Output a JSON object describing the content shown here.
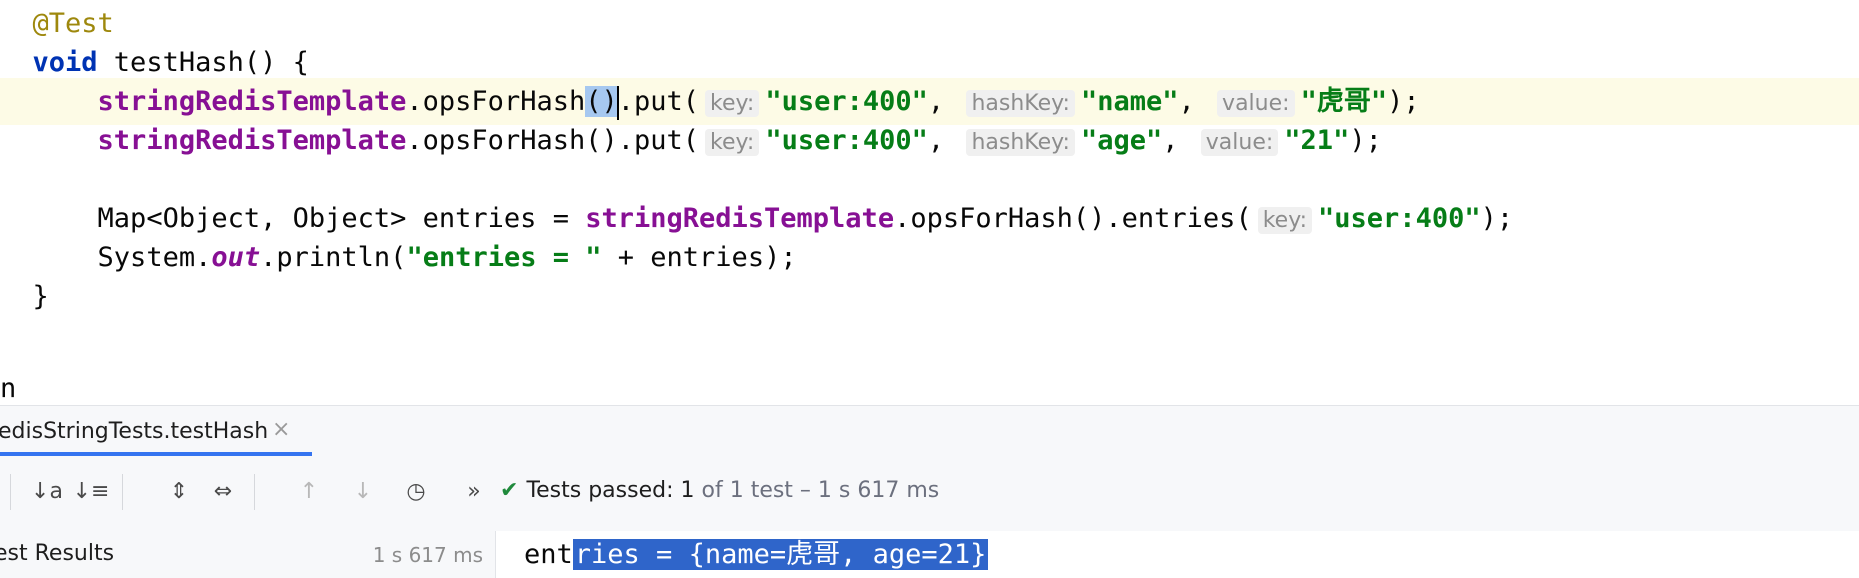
{
  "editor": {
    "annotation": "@Test",
    "method_kw": "void",
    "method_sig": " testHash() {",
    "line3": {
      "indent": "    ",
      "field": "stringRedisTemplate",
      "call": ".opsForHash",
      "sel": "()",
      "rest": ".put(",
      "hint_key": "key:",
      "arg_key": "\"user:400\"",
      "comma1": ",",
      "hint_hashkey": "hashKey:",
      "arg_hashkey": "\"name\"",
      "comma2": ",",
      "hint_value": "value:",
      "arg_value": "\"虎哥\"",
      "end": ");"
    },
    "line4": {
      "indent": "    ",
      "field": "stringRedisTemplate",
      "call": ".opsForHash().put(",
      "hint_key": "key:",
      "arg_key": "\"user:400\"",
      "comma1": ",",
      "hint_hashkey": "hashKey:",
      "arg_hashkey": "\"age\"",
      "comma2": ",",
      "hint_value": "value:",
      "arg_value": "\"21\"",
      "end": ");"
    },
    "line6": {
      "indent": "    ",
      "decl": "Map<Object, Object> entries = ",
      "field": "stringRedisTemplate",
      "call": ".opsForHash().entries(",
      "hint_key": "key:",
      "arg_key": "\"user:400\"",
      "end": ");"
    },
    "line7": {
      "indent": "    ",
      "sys": "System.",
      "out": "out",
      "print": ".println(",
      "str": "\"entries = \"",
      "end": " + entries);"
    },
    "close_brace": "}",
    "trailing": "n"
  },
  "run_panel": {
    "tab_label": "edisStringTests.testHash",
    "tab_close": "×",
    "toolbar": {
      "sort_alpha": "↓a",
      "sort_duration": "↓≡",
      "expand_all": "⇕",
      "collapse_all": "⇔",
      "prev": "↑",
      "next": "↓",
      "history": "◷",
      "more": "»"
    },
    "status_check": "✔",
    "status_text": "Tests passed:",
    "status_count": "1",
    "status_rest": "of 1 test – 1 s 617 ms",
    "results_label": "est Results",
    "results_time": "1 s 617 ms",
    "console_plain": "ent",
    "console_highlighted": "ries = {name=虎哥, age=21}"
  }
}
